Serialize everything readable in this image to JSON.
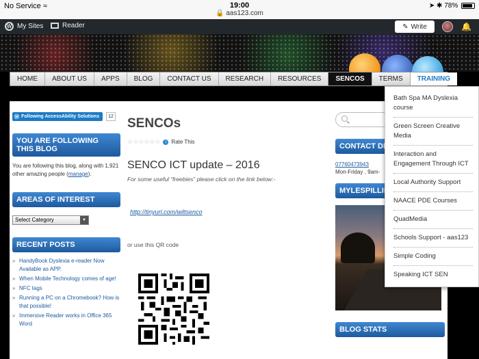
{
  "status_bar": {
    "carrier": "No Service",
    "time": "19:00",
    "url": "aas123.com",
    "battery": "78%"
  },
  "admin_bar": {
    "my_sites": "My Sites",
    "reader": "Reader",
    "write": "Write",
    "wp_letter": "W"
  },
  "nav": {
    "items": [
      "HOME",
      "ABOUT US",
      "APPS",
      "BLOG",
      "CONTACT US",
      "RESEARCH",
      "RESOURCES",
      "SENCOS",
      "TERMS",
      "TRAINING"
    ],
    "active": "SENCOS",
    "open": "TRAINING"
  },
  "training_menu": [
    "Bath Spa MA Dyslexia course",
    "Green Screen Creative Media",
    "Interaction and Engagement Through ICT",
    "Local Authority Support",
    "NAACE PDE Courses",
    "QuadMedia",
    "Schools Support - aas123",
    "Simple Coding",
    "Speaking ICT SEN"
  ],
  "left_sidebar": {
    "follow_badge": "Following AccessAbility Solutions",
    "follow_count": "12",
    "following_title": "YOU ARE FOLLOWING THIS BLOG",
    "following_text_pre": "You are following this blog, along with 1,921 other amazing people (",
    "manage_link": "manage",
    "following_text_post": ").",
    "areas_title": "AREAS OF INTEREST",
    "category_select": "Select Category",
    "recent_title": "RECENT POSTS",
    "recent_posts": [
      "HandyBook Dyslexia e-reader Now Available as APP.",
      "When Mobile Technology comes of age!",
      "NFC tags",
      "Running a PC on a Chromebook? How is that possible!",
      "Immersive Reader works in Office 365 Word"
    ]
  },
  "main": {
    "page_title": "SENCOs",
    "rate_label": "Rate This",
    "stars": "☆☆☆☆☆☆",
    "post_heading": "SENCO ICT update – 2016",
    "intro": "For some useful “freebies” please click on the link below:-",
    "link": "http://tinyurl.com/wiltsenco",
    "qr_text": "or use this QR code"
  },
  "right_sidebar": {
    "contact_title": "CONTACT DE",
    "phone": "07760473943",
    "hours": "Mon-Friday , 9am-",
    "twitter_title": "MYLESPILLIN",
    "stats_title": "BLOG STATS"
  },
  "colors": {
    "accent": "#1c7bc4",
    "widget": "#2b6fb8",
    "admin_bar": "#23282d"
  }
}
